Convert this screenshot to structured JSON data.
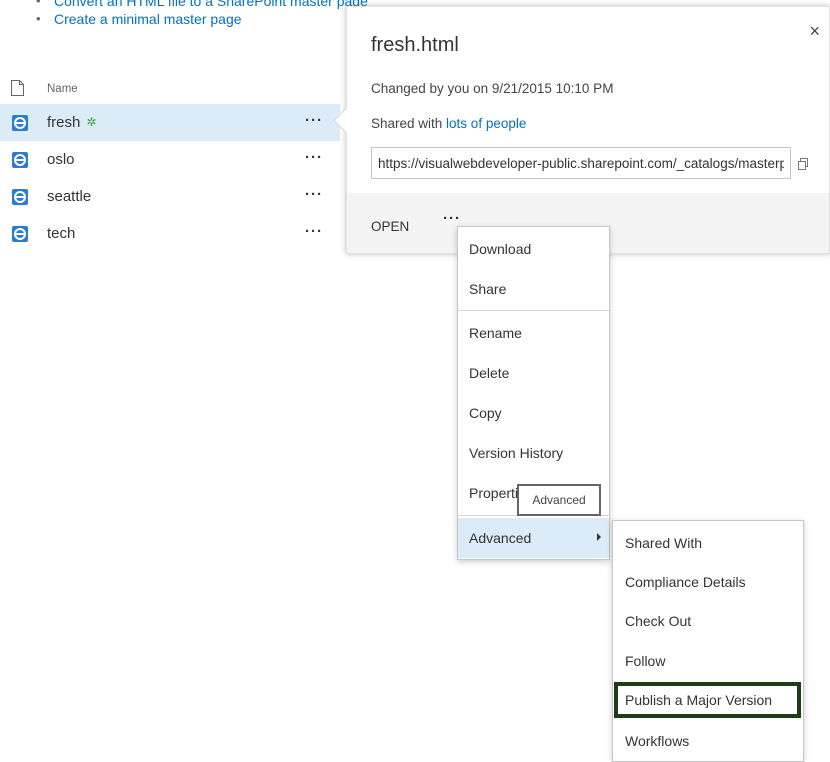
{
  "top_links": [
    {
      "label": "Convert an HTML file to a SharePoint master page"
    },
    {
      "label": "Create a minimal master page"
    }
  ],
  "file_list": {
    "column_header": "Name",
    "rows": [
      {
        "name": "fresh",
        "new_marker": "✲",
        "more": "···",
        "selected": true
      },
      {
        "name": "oslo",
        "more": "···"
      },
      {
        "name": "seattle",
        "more": "···"
      },
      {
        "name": "tech",
        "more": "···"
      }
    ]
  },
  "callout": {
    "title": "fresh.html",
    "close_icon": "×",
    "changed_text": "Changed by you on 9/21/2015 10:10 PM",
    "shared_prefix": "Shared with ",
    "shared_link": "lots of people",
    "url": "https://visualwebdeveloper-public.sharepoint.com/_catalogs/masterpage/fresh.html",
    "open_label": "OPEN",
    "more_label": "···"
  },
  "context_menu": {
    "items": [
      "Download",
      "Share",
      "Rename",
      "Delete",
      "Copy",
      "Version History",
      "Properties",
      "Advanced"
    ]
  },
  "tooltip": "Advanced",
  "submenu": {
    "items": [
      "Shared With",
      "Compliance Details",
      "Check Out",
      "Follow",
      "Publish a Major Version",
      "Workflows"
    ]
  },
  "colors": {
    "accent_link": "#0072c6",
    "selected_row": "#dcebf8",
    "action_bar": "#f4f4f4",
    "highlight_border": "#1e3d16",
    "new_marker": "#3aa23a"
  }
}
